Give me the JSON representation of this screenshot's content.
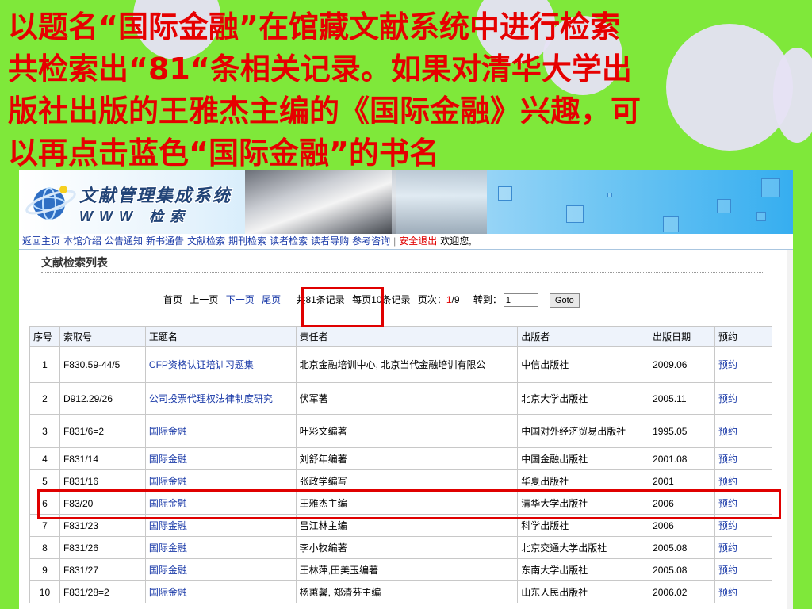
{
  "caption_lines": [
    "以题名“国际金融”在馆藏文献系统中进行检索",
    "共检索出“81“条相关记录。如果对清华大学出",
    "版社出版的王雅杰主编的《国际金融》兴趣，可",
    "以再点击蓝色“国际金融”的书名"
  ],
  "banner": {
    "title": "文献管理集成系统",
    "subtitle": "WWW 检索"
  },
  "nav": {
    "items": [
      "返回主页",
      "本馆介绍",
      "公告通知",
      "新书通告",
      "文献检索",
      "期刊检索",
      "读者检索",
      "读者导购",
      "参考咨询"
    ],
    "logout": "安全退出",
    "welcome": "欢迎您,"
  },
  "list_title": "文献检索列表",
  "pager": {
    "first": "首页",
    "prev": "上一页",
    "next": "下一页",
    "last": "尾页",
    "total": "共81条记录",
    "per_page": "每页10条记录",
    "page_label": "页次：",
    "page_current": "1",
    "page_total": "/9",
    "jump_label": "转到：",
    "jump_value": "1",
    "goto": "Goto"
  },
  "table": {
    "headers": [
      "序号",
      "索取号",
      "正题名",
      "责任者",
      "出版者",
      "出版日期",
      "预约"
    ],
    "rows": [
      [
        "1",
        "F830.59-44/5",
        "CFP资格认证培训习题集",
        "北京金融培训中心, 北京当代金融培训有限公",
        "中信出版社",
        "2009.06",
        "预约"
      ],
      [
        "2",
        "D912.29/26",
        "公司投票代理权法律制度研究",
        "伏军著",
        "北京大学出版社",
        "2005.11",
        "预约"
      ],
      [
        "3",
        "F831/6=2",
        "国际金融",
        "叶彩文编著",
        "中国对外经济贸易出版社",
        "1995.05",
        "预约"
      ],
      [
        "4",
        "F831/14",
        "国际金融",
        "刘舒年编著",
        "中国金融出版社",
        "2001.08",
        "预约"
      ],
      [
        "5",
        "F831/16",
        "国际金融",
        "张政学编写",
        "华夏出版社",
        "2001",
        "预约"
      ],
      [
        "6",
        "F83/20",
        "国际金融",
        "王雅杰主编",
        "清华大学出版社",
        "2006",
        "预约"
      ],
      [
        "7",
        "F831/23",
        "国际金融",
        "吕江林主编",
        "科学出版社",
        "2006",
        "预约"
      ],
      [
        "8",
        "F831/26",
        "国际金融",
        "李小牧编著",
        "北京交通大学出版社",
        "2005.08",
        "预约"
      ],
      [
        "9",
        "F831/27",
        "国际金融",
        "王林萍,田美玉编著",
        "东南大学出版社",
        "2005.08",
        "预约"
      ],
      [
        "10",
        "F831/28=2",
        "国际金融",
        "杨蕙馨, 郑清芬主编",
        "山东人民出版社",
        "2006.02",
        "预约"
      ]
    ],
    "row_heights": [
      46,
      40,
      42,
      28,
      28,
      28,
      28,
      28,
      28,
      28
    ]
  },
  "colors": {
    "background": "#7fe83a",
    "caption": "#e60000",
    "link": "#1a3aa8",
    "highlight": "#e00000"
  }
}
